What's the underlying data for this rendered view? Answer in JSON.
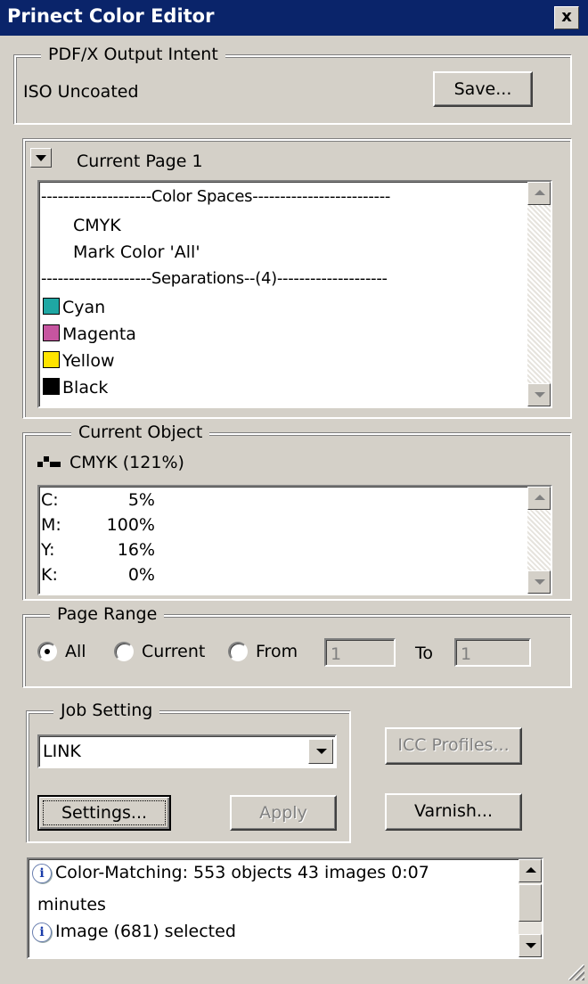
{
  "window": {
    "title": "Prinect Color Editor",
    "close_label": "x"
  },
  "output_intent": {
    "legend": "PDF/X Output Intent",
    "value": "ISO Uncoated",
    "save_label": "Save..."
  },
  "current_page": {
    "header": "Current Page 1",
    "color_spaces_sep": "--------------------Color Spaces-------------------------",
    "color_spaces": [
      "CMYK",
      "Mark Color 'All'"
    ],
    "separations_sep": "--------------------Separations--(4)--------------------",
    "separations": [
      {
        "name": "Cyan",
        "color": "#1fa7a3"
      },
      {
        "name": "Magenta",
        "color": "#c655a0"
      },
      {
        "name": "Yellow",
        "color": "#ffe400"
      },
      {
        "name": "Black",
        "color": "#000000"
      }
    ]
  },
  "current_object": {
    "legend": "Current Object",
    "label": "CMYK (121%)",
    "values": [
      {
        "channel": "C:",
        "value": "5%"
      },
      {
        "channel": "M:",
        "value": "100%"
      },
      {
        "channel": "Y:",
        "value": "16%"
      },
      {
        "channel": "K:",
        "value": "0%"
      }
    ]
  },
  "page_range": {
    "legend": "Page Range",
    "options": [
      "All",
      "Current",
      "From"
    ],
    "selected": "All",
    "from_value": "1",
    "to_label": "To",
    "to_value": "1"
  },
  "job_setting": {
    "legend": "Job Setting",
    "selected": "LINK",
    "settings_label": "Settings...",
    "apply_label": "Apply"
  },
  "side_buttons": {
    "icc_label": "ICC Profiles...",
    "varnish_label": "Varnish..."
  },
  "log": {
    "entries": [
      {
        "line1": "Color-Matching: 553 objects 43 images 0:07",
        "line2": "minutes"
      },
      {
        "line1": "Image (681) selected"
      }
    ]
  }
}
